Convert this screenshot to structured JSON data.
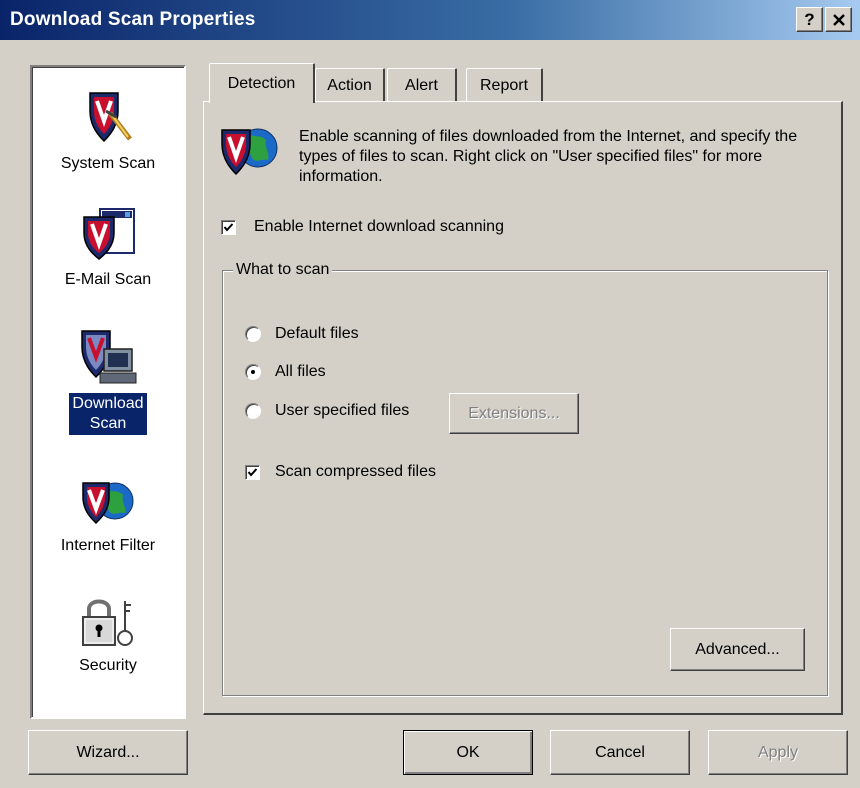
{
  "window": {
    "title": "Download Scan Properties",
    "help_label": "?",
    "close_label": "✕"
  },
  "sidebar": {
    "items": [
      {
        "label": "System Scan",
        "icon": "system-scan-icon",
        "selected": false
      },
      {
        "label": "E-Mail Scan",
        "icon": "email-scan-icon",
        "selected": false
      },
      {
        "label": "Download Scan",
        "label_line1": "Download",
        "label_line2": "Scan",
        "icon": "download-scan-icon",
        "selected": true
      },
      {
        "label": "Internet Filter",
        "icon": "internet-filter-icon",
        "selected": false
      },
      {
        "label": "Security",
        "icon": "security-lock-icon",
        "selected": false
      }
    ]
  },
  "tabs": [
    {
      "label": "Detection",
      "active": true
    },
    {
      "label": "Action",
      "active": false
    },
    {
      "label": "Alert",
      "active": false
    },
    {
      "label": "Report",
      "active": false
    }
  ],
  "detection": {
    "info_text": "Enable scanning of files downloaded from the Internet, and specify the types of files to scan. Right click on \"User specified files\" for more information.",
    "enable_label": "Enable Internet download scanning",
    "enable_checked": true,
    "group_title": "What to scan",
    "options": [
      {
        "label": "Default files",
        "selected": false
      },
      {
        "label": "All files",
        "selected": true
      },
      {
        "label": "User specified files",
        "selected": false
      }
    ],
    "extensions_label": "Extensions...",
    "compressed_label": "Scan compressed files",
    "compressed_checked": true,
    "advanced_label": "Advanced..."
  },
  "footer": {
    "wizard_label": "Wizard...",
    "ok_label": "OK",
    "cancel_label": "Cancel",
    "apply_label": "Apply"
  },
  "colors": {
    "titlebar_start": "#0a246a",
    "titlebar_end": "#a6caf0",
    "face": "#d4d0c8",
    "selection": "#0a246a",
    "shield_red": "#c8102e",
    "shield_navy": "#1c2a6b"
  }
}
